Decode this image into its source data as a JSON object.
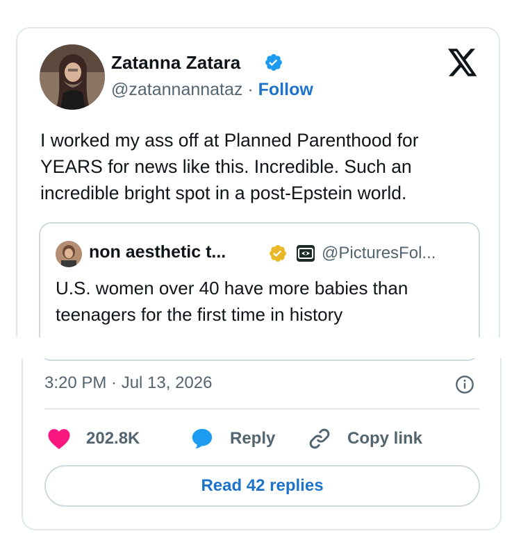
{
  "author": {
    "name": "Zatanna Zatara",
    "handle": "@zatannannataz",
    "separator": "·",
    "follow_label": "Follow",
    "verified_badge": "blue-check-icon"
  },
  "brand_logo": "x-logo-icon",
  "tweet_text": "I worked my ass off at Planned Parenthood for YEARS for news like this. Incredible. Such an incredible bright spot in a post-Epstein world.",
  "quoted": {
    "name": "non aesthetic t...",
    "handle": "@PicturesFol...",
    "verified_badge": "gold-check-icon",
    "affiliate_badge": "affiliate-icon",
    "text": "U.S. women over 40 have more babies than teenagers for the first time in history"
  },
  "timestamp": "3:20 PM · Jul 13, 2026",
  "actions": {
    "like_count": "202.8K",
    "reply_label": "Reply",
    "copy_label": "Copy link"
  },
  "read_replies_label": "Read 42 replies",
  "colors": {
    "link": "#1d73c9",
    "verified": "#1d9bf0",
    "gold": "#e8b829",
    "like": "#f91880",
    "muted": "#536471",
    "border": "#e1e8ed"
  }
}
